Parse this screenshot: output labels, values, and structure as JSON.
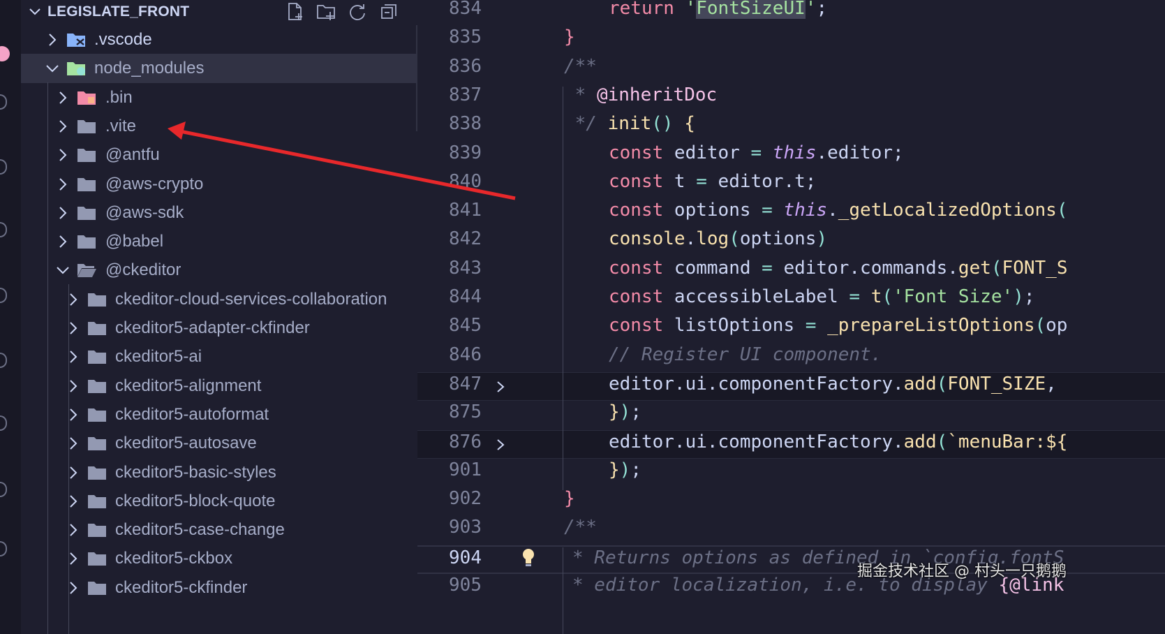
{
  "explorer": {
    "title": "LEGISLATE_FRONT",
    "actions": [
      "new-file-icon",
      "new-folder-icon",
      "refresh-icon",
      "collapse-all-icon"
    ],
    "items": [
      {
        "label": ".vscode",
        "depth": 0,
        "expanded": false,
        "icon": "vscode-folder-icon",
        "color": "#89b4fa"
      },
      {
        "label": "node_modules",
        "depth": 0,
        "expanded": true,
        "icon": "node-folder-icon",
        "color": "#a6e3a1",
        "active": true
      },
      {
        "label": ".bin",
        "depth": 1,
        "expanded": false,
        "icon": "bin-folder-icon",
        "color": "#f38ba8"
      },
      {
        "label": ".vite",
        "depth": 1,
        "expanded": false,
        "icon": "folder-icon"
      },
      {
        "label": "@antfu",
        "depth": 1,
        "expanded": false,
        "icon": "folder-icon"
      },
      {
        "label": "@aws-crypto",
        "depth": 1,
        "expanded": false,
        "icon": "folder-icon"
      },
      {
        "label": "@aws-sdk",
        "depth": 1,
        "expanded": false,
        "icon": "folder-icon"
      },
      {
        "label": "@babel",
        "depth": 1,
        "expanded": false,
        "icon": "folder-icon"
      },
      {
        "label": "@ckeditor",
        "depth": 1,
        "expanded": true,
        "icon": "folder-open-icon"
      },
      {
        "label": "ckeditor-cloud-services-collaboration",
        "depth": 2,
        "expanded": false,
        "icon": "folder-icon"
      },
      {
        "label": "ckeditor5-adapter-ckfinder",
        "depth": 2,
        "expanded": false,
        "icon": "folder-icon"
      },
      {
        "label": "ckeditor5-ai",
        "depth": 2,
        "expanded": false,
        "icon": "folder-icon"
      },
      {
        "label": "ckeditor5-alignment",
        "depth": 2,
        "expanded": false,
        "icon": "folder-icon"
      },
      {
        "label": "ckeditor5-autoformat",
        "depth": 2,
        "expanded": false,
        "icon": "folder-icon"
      },
      {
        "label": "ckeditor5-autosave",
        "depth": 2,
        "expanded": false,
        "icon": "folder-icon"
      },
      {
        "label": "ckeditor5-basic-styles",
        "depth": 2,
        "expanded": false,
        "icon": "folder-icon"
      },
      {
        "label": "ckeditor5-block-quote",
        "depth": 2,
        "expanded": false,
        "icon": "folder-icon"
      },
      {
        "label": "ckeditor5-case-change",
        "depth": 2,
        "expanded": false,
        "icon": "folder-icon"
      },
      {
        "label": "ckeditor5-ckbox",
        "depth": 2,
        "expanded": false,
        "icon": "folder-icon"
      },
      {
        "label": "ckeditor5-ckfinder",
        "depth": 2,
        "expanded": false,
        "icon": "folder-icon"
      }
    ]
  },
  "editor": {
    "current_line": "904",
    "lines": [
      {
        "num": "834",
        "tokens": [
          [
            "kw",
            "return "
          ],
          [
            "str",
            "'"
          ],
          [
            "strhl",
            "FontSizeUI"
          ],
          [
            "str",
            "'"
          ],
          [
            "v",
            ";"
          ]
        ]
      },
      {
        "num": "835",
        "tokens": [
          [
            "br",
            "}"
          ]
        ]
      },
      {
        "num": "836",
        "tokens": [
          [
            "cm",
            "/**"
          ]
        ]
      },
      {
        "num": "837",
        "tokens": [
          [
            "cm",
            " * "
          ],
          [
            "tag",
            "@inheritDoc"
          ]
        ]
      },
      {
        "num": "838",
        "tokens": [
          [
            "cm",
            " */ "
          ],
          [
            "fn",
            "init"
          ],
          [
            "op",
            "() "
          ],
          [
            "fn",
            "{"
          ]
        ]
      },
      {
        "num": "839",
        "tokens": [
          [
            "kw",
            "const "
          ],
          [
            "v",
            "editor "
          ],
          [
            "op",
            "= "
          ],
          [
            "it",
            "this"
          ],
          [
            "v",
            ".editor;"
          ]
        ]
      },
      {
        "num": "840",
        "tokens": [
          [
            "kw",
            "const "
          ],
          [
            "v",
            "t "
          ],
          [
            "op",
            "= "
          ],
          [
            "v",
            "editor.t;"
          ]
        ]
      },
      {
        "num": "841",
        "tokens": [
          [
            "kw",
            "const "
          ],
          [
            "v",
            "options "
          ],
          [
            "op",
            "= "
          ],
          [
            "it",
            "this"
          ],
          [
            "v",
            "."
          ],
          [
            "fn",
            "_getLocalizedOptions"
          ],
          [
            "op",
            "("
          ]
        ]
      },
      {
        "num": "842",
        "tokens": [
          [
            "fn",
            "console"
          ],
          [
            "v",
            "."
          ],
          [
            "fn",
            "log"
          ],
          [
            "op",
            "("
          ],
          [
            "v",
            "options"
          ],
          [
            "op",
            ")"
          ]
        ]
      },
      {
        "num": "843",
        "tokens": [
          [
            "kw",
            "const "
          ],
          [
            "v",
            "command "
          ],
          [
            "op",
            "= "
          ],
          [
            "v",
            "editor.commands."
          ],
          [
            "fn",
            "get"
          ],
          [
            "op",
            "("
          ],
          [
            "fn",
            "FONT_S"
          ]
        ]
      },
      {
        "num": "844",
        "tokens": [
          [
            "kw",
            "const "
          ],
          [
            "v",
            "accessibleLabel "
          ],
          [
            "op",
            "= "
          ],
          [
            "fn",
            "t"
          ],
          [
            "op",
            "("
          ],
          [
            "str",
            "'Font Size'"
          ],
          [
            "op",
            ")"
          ],
          [
            "v",
            ";"
          ]
        ]
      },
      {
        "num": "845",
        "tokens": [
          [
            "kw",
            "const "
          ],
          [
            "v",
            "listOptions "
          ],
          [
            "op",
            "= "
          ],
          [
            "fn",
            "_prepareListOptions"
          ],
          [
            "op",
            "("
          ],
          [
            "v",
            "op"
          ]
        ]
      },
      {
        "num": "846",
        "tokens": [
          [
            "cm",
            "// Register UI component."
          ]
        ]
      },
      {
        "num": "847",
        "folded": true,
        "tokens": [
          [
            "v",
            "editor.ui.componentFactory."
          ],
          [
            "fn",
            "add"
          ],
          [
            "op",
            "("
          ],
          [
            "fn",
            "FONT_SIZE"
          ],
          [
            "v",
            ","
          ]
        ]
      },
      {
        "num": "875",
        "tokens": [
          [
            "fn",
            "}"
          ],
          [
            "op",
            ")"
          ],
          [
            "v",
            ";"
          ]
        ]
      },
      {
        "num": "876",
        "folded": true,
        "tokens": [
          [
            "v",
            "editor.ui.componentFactory."
          ],
          [
            "fn",
            "add"
          ],
          [
            "op",
            "("
          ],
          [
            "fn",
            "`menuBar:${"
          ]
        ]
      },
      {
        "num": "901",
        "tokens": [
          [
            "fn",
            "}"
          ],
          [
            "op",
            ")"
          ],
          [
            "v",
            ";"
          ]
        ]
      },
      {
        "num": "902",
        "tokens": [
          [
            "br",
            "}"
          ]
        ]
      },
      {
        "num": "903",
        "tokens": [
          [
            "cm",
            "/**"
          ]
        ]
      },
      {
        "num": "904",
        "current": true,
        "tokens": [
          [
            "cm",
            "* Returns options as defined in `config.fontS"
          ]
        ]
      },
      {
        "num": "905",
        "tokens": [
          [
            "cm",
            "* editor localization, i.e. to display "
          ],
          [
            "tag",
            "{@link"
          ]
        ]
      }
    ]
  },
  "annotation": {
    "color": "#e8282b"
  },
  "watermark": "掘金技术社区 @ 村头一只鹅鹅"
}
